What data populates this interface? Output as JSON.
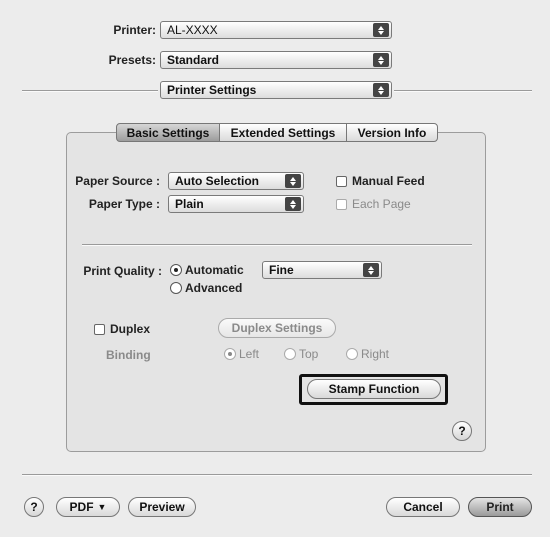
{
  "header": {
    "printer": {
      "label": "Printer:",
      "value": "AL-XXXX"
    },
    "presets": {
      "label": "Presets:",
      "value": "Standard"
    },
    "panel_select": "Printer Settings"
  },
  "tabs": [
    {
      "label": "Basic Settings",
      "selected": true
    },
    {
      "label": "Extended Settings",
      "selected": false
    },
    {
      "label": "Version Info",
      "selected": false
    }
  ],
  "paper": {
    "source_label": "Paper Source :",
    "source_value": "Auto Selection",
    "type_label": "Paper Type :",
    "type_value": "Plain",
    "manual_feed": "Manual Feed",
    "each_page": "Each Page"
  },
  "quality": {
    "label": "Print Quality :",
    "automatic": "Automatic",
    "advanced": "Advanced",
    "mode_value": "Fine",
    "selected": "Automatic"
  },
  "duplex": {
    "label": "Duplex",
    "settings_button": "Duplex Settings",
    "binding_label": "Binding",
    "left": "Left",
    "top": "Top",
    "right": "Right",
    "selected_binding": "Left"
  },
  "stamp_button": "Stamp Function",
  "help_symbol": "?",
  "footer": {
    "pdf": "PDF",
    "preview": "Preview",
    "cancel": "Cancel",
    "print": "Print"
  },
  "colors": {
    "background": "#ececec",
    "highlight_border": "#111111"
  }
}
